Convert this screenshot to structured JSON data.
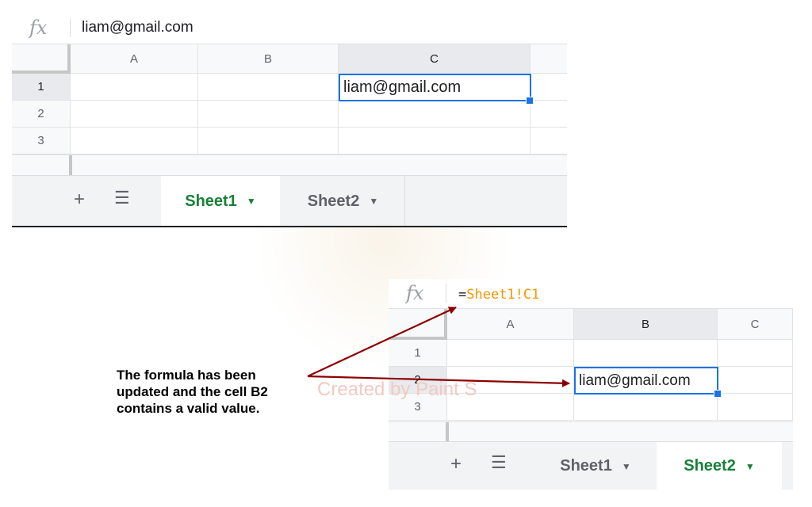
{
  "sheet1_view": {
    "fx_label": "fx",
    "formula_value": "liam@gmail.com",
    "columns": [
      "A",
      "B",
      "C"
    ],
    "rows": [
      "1",
      "2",
      "3"
    ],
    "cell_c1_value": "liam@gmail.com",
    "tabs": [
      {
        "label": "Sheet1",
        "active": true
      },
      {
        "label": "Sheet2",
        "active": false
      }
    ],
    "add_sheet_icon": "plus-icon",
    "all_sheets_icon": "list-icon"
  },
  "sheet2_view": {
    "fx_label": "fx",
    "formula_prefix": "=",
    "formula_ref": "Sheet1!C1",
    "columns": [
      "A",
      "B",
      "C"
    ],
    "rows": [
      "1",
      "2",
      "3"
    ],
    "cell_b2_value": "liam@gmail.com",
    "tabs": [
      {
        "label": "Sheet1",
        "active": false
      },
      {
        "label": "Sheet2",
        "active": true
      }
    ],
    "add_sheet_icon": "plus-icon",
    "all_sheets_icon": "list-icon"
  },
  "annotation": {
    "line1": "The formula has been",
    "line2": "updated and the cell B2",
    "line3": "contains a valid value."
  },
  "watermark": "Created by Paint S",
  "colors": {
    "selection": "#1a73e8",
    "active_tab_text": "#188038",
    "formula_reference": "#f29900",
    "arrow": "#8b0000"
  }
}
